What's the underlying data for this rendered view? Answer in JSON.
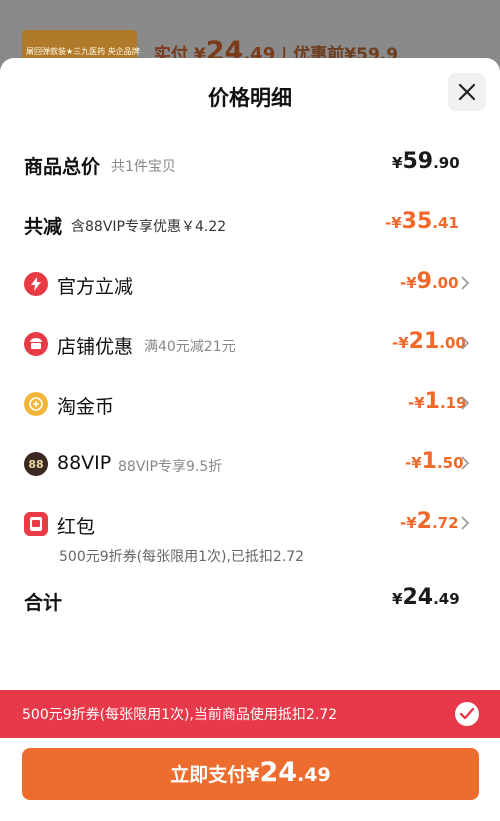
{
  "background": {
    "thumb_text": "屠回弹款装★三九医药 央企品牌",
    "pay_label": "实付",
    "pay_symbol": "¥",
    "pay_int": "24",
    "pay_dec": ".49",
    "divider": "|",
    "before_text": "优惠前¥59.9"
  },
  "sheet": {
    "title": "价格明细"
  },
  "rows": [
    {
      "label": "商品总价",
      "sub": "共1件宝贝",
      "sign": "",
      "symbol": "¥",
      "int": "59",
      "dec": ".90",
      "color": "#1a1a1a"
    },
    {
      "label": "共减",
      "sub": "含88VIP专享优惠￥4.22",
      "sign": "-",
      "symbol": "¥",
      "int": "35",
      "dec": ".41",
      "color": "#f0692a"
    },
    {
      "label": "官方立减",
      "icon": "lightning-icon",
      "icon_color": "#e83b45",
      "sign": "-",
      "symbol": "¥",
      "int": "9",
      "dec": ".00",
      "color": "#f0692a"
    },
    {
      "label": "店铺优惠",
      "sub": "满40元减21元",
      "icon": "shop-icon",
      "icon_color": "#e83b45",
      "sign": "-",
      "symbol": "¥",
      "int": "21",
      "dec": ".00",
      "color": "#f0692a"
    },
    {
      "label": "淘金币",
      "icon": "coin-icon",
      "icon_color": "#f4b63a",
      "sign": "-",
      "symbol": "¥",
      "int": "1",
      "dec": ".19",
      "color": "#f0692a"
    },
    {
      "label": "88VIP",
      "sub": "88VIP专享9.5折",
      "icon": "vip-88-icon",
      "icon_glyph": "88",
      "icon_color": "#3a2a22",
      "sign": "-",
      "symbol": "¥",
      "int": "1",
      "dec": ".50",
      "color": "#f0692a"
    },
    {
      "label": "红包",
      "icon": "red-packet-icon",
      "icon_color": "#e83b45",
      "sign": "-",
      "symbol": "¥",
      "int": "2",
      "dec": ".72",
      "color": "#f0692a"
    }
  ],
  "red_packet_note": "500元9折券(每张限用1次),已抵扣2.72",
  "total": {
    "label": "合计",
    "symbol": "¥",
    "int": "24",
    "dec": ".49"
  },
  "banner": {
    "text": "500元9折券(每张限用1次),当前商品使用抵扣2.72"
  },
  "pay_button": {
    "label": "立即支付",
    "symbol": "¥",
    "int": "24",
    "dec": ".49"
  },
  "colors": {
    "accent": "#ed6d2f",
    "banner": "#e8394a",
    "discount": "#f0692a"
  }
}
